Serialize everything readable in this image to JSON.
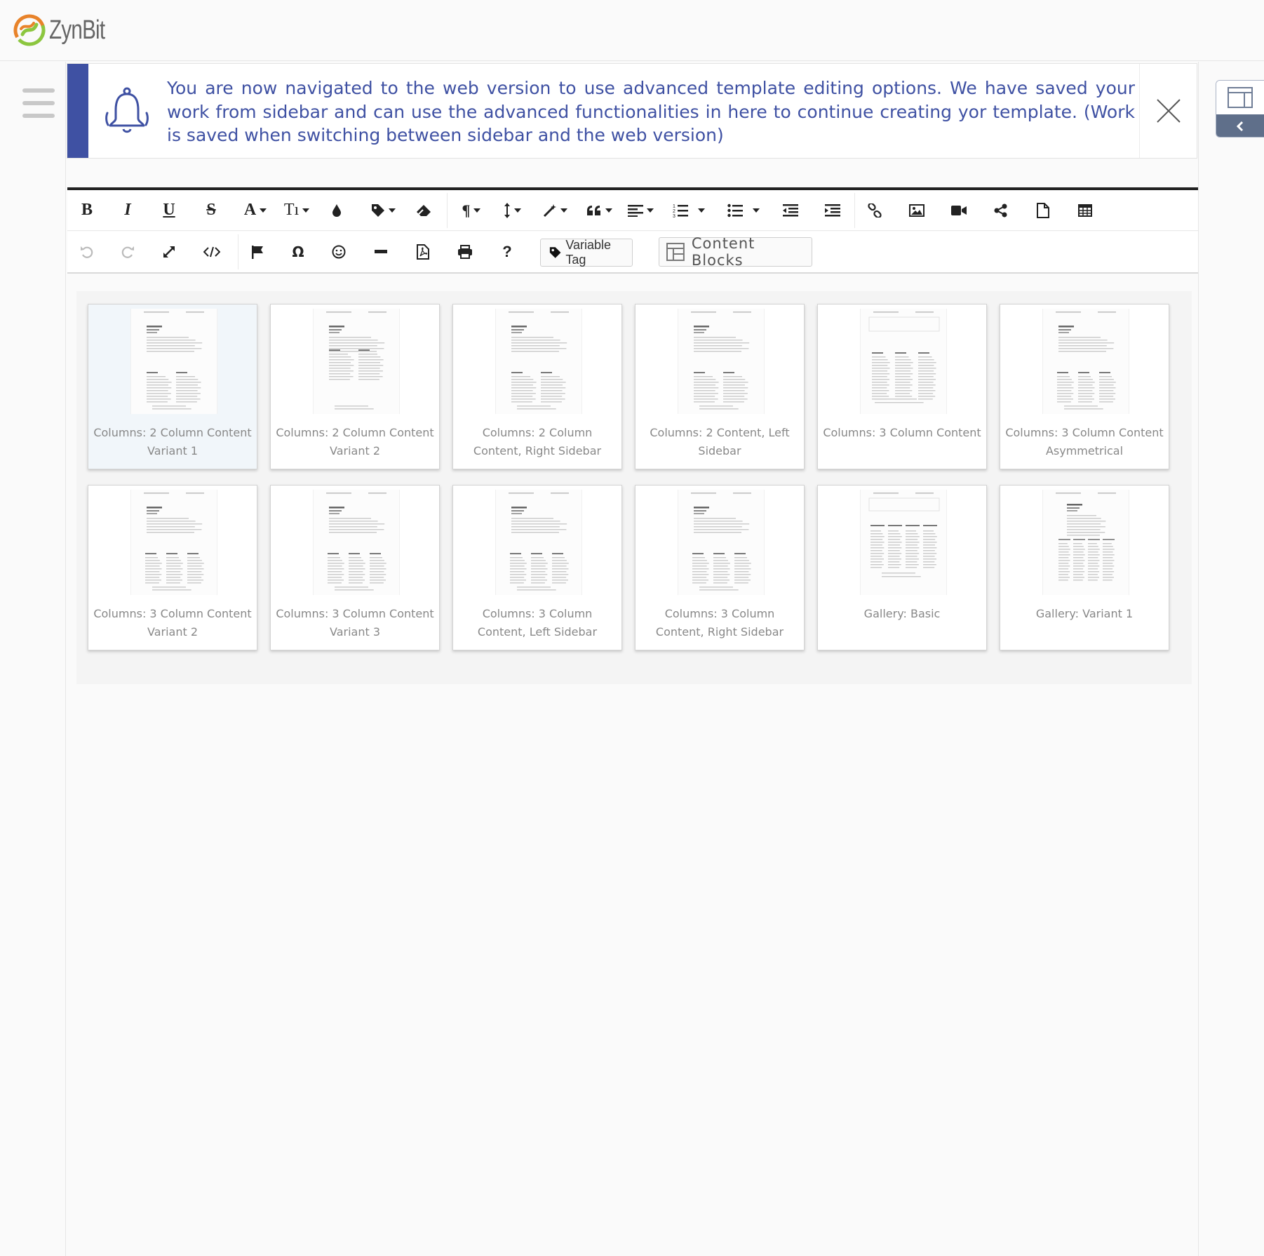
{
  "app": {
    "logo_text": "ZynBit"
  },
  "notification": {
    "message": "You are now navigated to the web version to use advanced template editing options. We have saved your work from sidebar and can use the advanced functionalities in here to continue creating yor template. (Work is saved when switching between sidebar and the web version)",
    "accent_color": "#3f51a3"
  },
  "toolbar": {
    "row1": [
      {
        "name": "bold-button",
        "icon": "B"
      },
      {
        "name": "italic-button",
        "icon": "I"
      },
      {
        "name": "underline-button",
        "icon": "U"
      },
      {
        "name": "strikethrough-button",
        "icon": "S"
      },
      {
        "name": "font-family-dropdown",
        "icon": "A"
      },
      {
        "name": "font-size-dropdown",
        "icon": "TI"
      },
      {
        "name": "text-color-button",
        "icon": "drop-icon"
      },
      {
        "name": "tag-dropdown",
        "icon": "tag-icon"
      },
      {
        "name": "clear-formatting-button",
        "icon": "eraser-icon"
      },
      {
        "name": "paragraph-format-dropdown",
        "icon": "pilcrow-icon"
      },
      {
        "name": "line-height-dropdown",
        "icon": "line-height-icon"
      },
      {
        "name": "inline-style-dropdown",
        "icon": "magic-wand-icon"
      },
      {
        "name": "quote-dropdown",
        "icon": "quote-icon"
      },
      {
        "name": "align-dropdown",
        "icon": "align-left-icon"
      },
      {
        "name": "ordered-list-dropdown",
        "icon": "ordered-list-icon"
      },
      {
        "name": "unordered-list-dropdown",
        "icon": "unordered-list-icon"
      },
      {
        "name": "outdent-button",
        "icon": "outdent-icon"
      },
      {
        "name": "indent-button",
        "icon": "indent-icon"
      },
      {
        "name": "insert-link-button",
        "icon": "link-icon"
      },
      {
        "name": "insert-image-button",
        "icon": "image-icon"
      },
      {
        "name": "insert-video-button",
        "icon": "video-icon"
      },
      {
        "name": "share-button",
        "icon": "share-icon"
      },
      {
        "name": "insert-file-button",
        "icon": "file-icon"
      },
      {
        "name": "insert-table-button",
        "icon": "table-icon"
      }
    ],
    "row2": [
      {
        "name": "undo-button",
        "icon": "undo-icon"
      },
      {
        "name": "redo-button",
        "icon": "redo-icon"
      },
      {
        "name": "fullscreen-button",
        "icon": "expand-icon"
      },
      {
        "name": "code-view-button",
        "icon": "code-icon"
      },
      {
        "name": "flag-button",
        "icon": "flag-icon"
      },
      {
        "name": "special-chars-button",
        "icon": "omega-icon"
      },
      {
        "name": "emoticons-button",
        "icon": "smile-icon"
      },
      {
        "name": "horizontal-line-button",
        "icon": "minus-icon"
      },
      {
        "name": "pdf-button",
        "icon": "pdf-icon"
      },
      {
        "name": "print-button",
        "icon": "print-icon"
      },
      {
        "name": "help-button",
        "icon": "question-icon"
      }
    ],
    "variable_tag_label": "Variable Tag",
    "content_blocks_label": "Content Blocks"
  },
  "content_blocks": [
    {
      "label": "Columns: 2 Column Content Variant 1",
      "thumbnail": "2-col-v1",
      "selected": true
    },
    {
      "label": "Columns: 2 Column Content Variant 2",
      "thumbnail": "2-col-v2",
      "selected": false
    },
    {
      "label": "Columns: 2 Column Content, Right Sidebar",
      "thumbnail": "2-col-right",
      "selected": false
    },
    {
      "label": "Columns: 2 Content, Left Sidebar",
      "thumbnail": "2-col-left",
      "selected": false
    },
    {
      "label": "Columns: 3 Column Content",
      "thumbnail": "3-col",
      "selected": false
    },
    {
      "label": "Columns: 3 Column Content Asymmetrical",
      "thumbnail": "3-col-asym",
      "selected": false
    },
    {
      "label": "Columns: 3 Column Content Variant 2",
      "thumbnail": "3-col-v2",
      "selected": false
    },
    {
      "label": "Columns: 3 Column Content Variant 3",
      "thumbnail": "3-col-v3",
      "selected": false
    },
    {
      "label": "Columns: 3 Column Content, Left Sidebar",
      "thumbnail": "3-col-left",
      "selected": false
    },
    {
      "label": "Columns: 3 Column Content, Right Sidebar",
      "thumbnail": "3-col-right",
      "selected": false
    },
    {
      "label": "Gallery: Basic",
      "thumbnail": "gallery-basic",
      "selected": false
    },
    {
      "label": "Gallery: Variant 1",
      "thumbnail": "gallery-v1",
      "selected": false
    }
  ]
}
